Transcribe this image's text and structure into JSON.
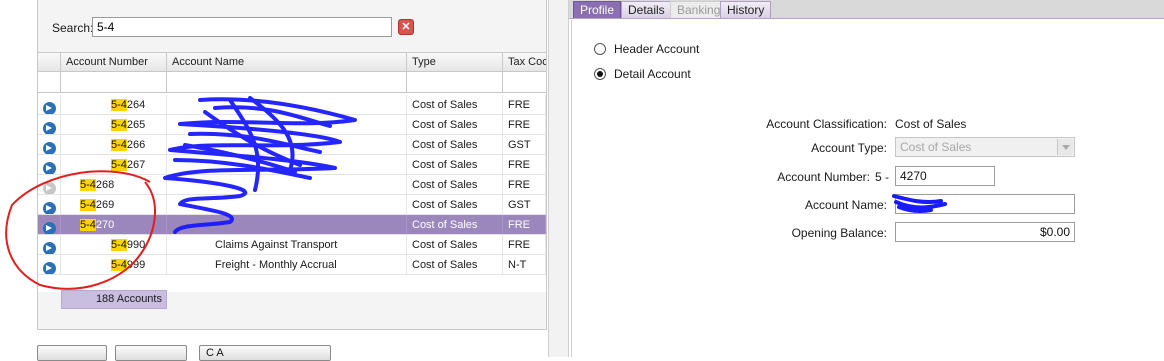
{
  "search": {
    "label": "Search:",
    "value": "5-4",
    "clear_icon": "clear-search-icon"
  },
  "grid": {
    "columns": [
      "Account Number",
      "Account Name",
      "Type",
      "Tax Coc"
    ],
    "rows": [
      {
        "number_hl": "5-4",
        "number_rest": "264",
        "name": "",
        "type": "Cost of Sales",
        "tax": "FRE",
        "icon": "arrow-right-icon",
        "inactive": false,
        "selected": false
      },
      {
        "number_hl": "5-4",
        "number_rest": "265",
        "name": "",
        "type": "Cost of Sales",
        "tax": "FRE",
        "icon": "arrow-right-icon",
        "inactive": false,
        "selected": false
      },
      {
        "number_hl": "5-4",
        "number_rest": "266",
        "name": "",
        "type": "Cost of Sales",
        "tax": "GST",
        "icon": "arrow-right-icon",
        "inactive": false,
        "selected": false
      },
      {
        "number_hl": "5-4",
        "number_rest": "267",
        "name": "",
        "type": "Cost of Sales",
        "tax": "FRE",
        "icon": "arrow-right-icon",
        "inactive": false,
        "selected": false
      },
      {
        "number_hl": "5-4",
        "number_rest": "268",
        "name": "",
        "type": "Cost of Sales",
        "tax": "FRE",
        "icon": "arrow-right-icon",
        "inactive": true,
        "selected": false
      },
      {
        "number_hl": "5-4",
        "number_rest": "269",
        "name": "",
        "type": "Cost of Sales",
        "tax": "GST",
        "icon": "arrow-right-icon",
        "inactive": false,
        "selected": false
      },
      {
        "number_hl": "5-4",
        "number_rest": "270",
        "name": "",
        "type": "Cost of Sales",
        "tax": "FRE",
        "icon": "arrow-right-icon",
        "inactive": false,
        "selected": true
      },
      {
        "number_hl": "5-4",
        "number_rest": "990",
        "name": "Claims Against Transport",
        "type": "Cost of Sales",
        "tax": "FRE",
        "icon": "arrow-right-icon",
        "inactive": false,
        "selected": false
      },
      {
        "number_hl": "5-4",
        "number_rest": "999",
        "name": "Freight - Monthly Accrual",
        "type": "Cost of Sales",
        "tax": "N-T",
        "icon": "arrow-right-icon",
        "inactive": false,
        "selected": false
      }
    ],
    "status": "188 Accounts"
  },
  "bottom_buttons": [
    "",
    "",
    "C          A"
  ],
  "tabs": [
    {
      "label": "Profile",
      "state": "active"
    },
    {
      "label": "Details",
      "state": "normal"
    },
    {
      "label": "Banking",
      "state": "disabled"
    },
    {
      "label": "History",
      "state": "normal"
    }
  ],
  "profile": {
    "header_account_label": "Header Account",
    "detail_account_label": "Detail Account",
    "selected_kind": "detail",
    "classification_label": "Account Classification:",
    "classification_value": "Cost of Sales",
    "type_label": "Account Type:",
    "type_value": "Cost of Sales",
    "number_label": "Account Number:",
    "number_prefix": "5 -",
    "number_value": "4270",
    "name_label": "Account Name:",
    "name_value": "",
    "opening_label": "Opening Balance:",
    "opening_value": "$0.00"
  },
  "colors": {
    "selection": "#9c87bd",
    "highlight": "#ffd400",
    "tab_active": "#8a6fb1",
    "scribble": "#1a1aff",
    "annotation": "#e02020"
  }
}
